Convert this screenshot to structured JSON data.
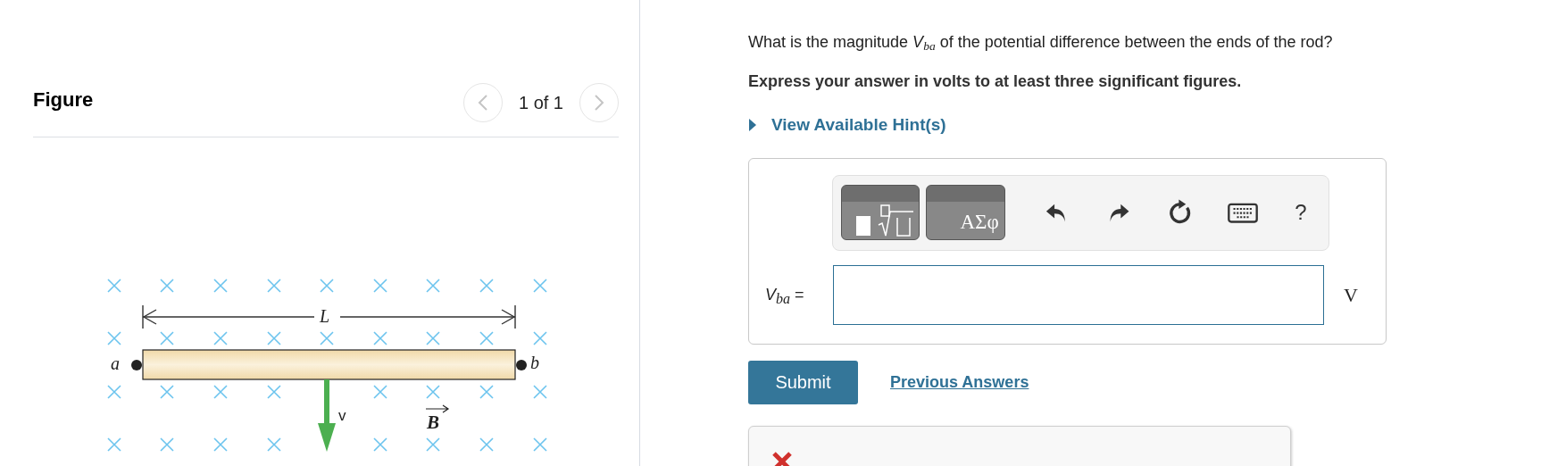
{
  "figure_panel": {
    "title": "Figure",
    "pager": {
      "previous_disabled": true,
      "text": "1 of 1",
      "next_disabled": true
    },
    "figure": {
      "left_end": "a",
      "right_end": "b",
      "length": "L",
      "velocity": "v",
      "field": "B"
    }
  },
  "question": {
    "prompt": "What is the magnitude *V*$_{ba}$ of the potential difference between the ends of the rod?",
    "instruction": "Express your answer in volts to at least three significant figures.",
    "hint_link": "View Available Hint(s)"
  },
  "answer": {
    "tools": [
      {
        "kind": "templates"
      },
      {
        "kind": "symbols",
        "label": "ΑΣφ"
      },
      {
        "kind": "undo"
      },
      {
        "kind": "redo"
      },
      {
        "kind": "reset"
      },
      {
        "kind": "keyboard"
      },
      {
        "kind": "help",
        "label": "?"
      }
    ],
    "label": "*V*$_{ba}$ =",
    "unit": "V"
  },
  "actions": {
    "submit": "Submit",
    "previous_answers": "Previous Answers"
  },
  "feedback": {
    "kind": "incorrect"
  }
}
